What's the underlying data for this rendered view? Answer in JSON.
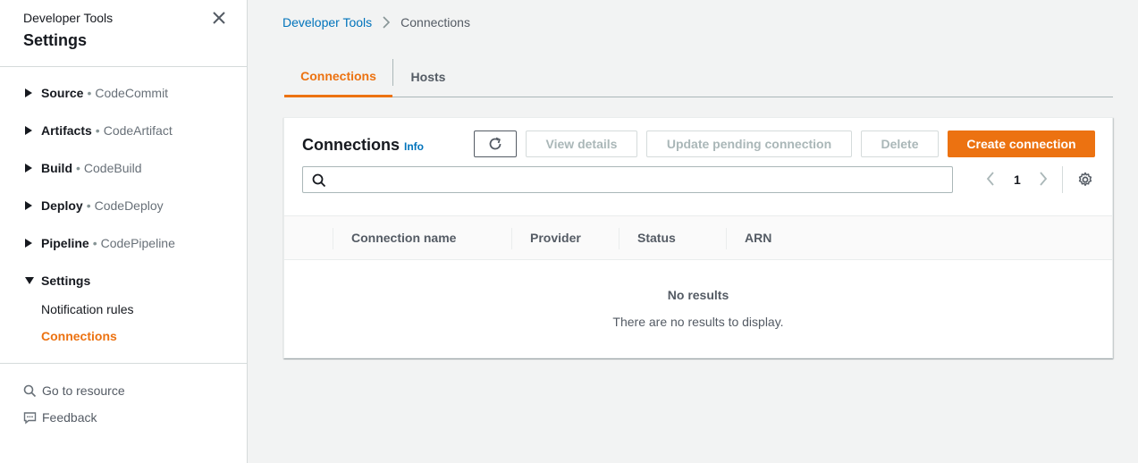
{
  "sidebar": {
    "header_sup": "Developer Tools",
    "title": "Settings",
    "items": [
      {
        "label": "Source",
        "sub": "CodeCommit"
      },
      {
        "label": "Artifacts",
        "sub": "CodeArtifact"
      },
      {
        "label": "Build",
        "sub": "CodeBuild"
      },
      {
        "label": "Deploy",
        "sub": "CodeDeploy"
      },
      {
        "label": "Pipeline",
        "sub": "CodePipeline"
      },
      {
        "label": "Settings",
        "children": [
          "Notification rules",
          "Connections"
        ]
      }
    ],
    "dot": "•",
    "go_to_resource": "Go to resource",
    "feedback": "Feedback"
  },
  "breadcrumb": {
    "root": "Developer Tools",
    "current": "Connections"
  },
  "tabs": [
    {
      "label": "Connections",
      "active": true
    },
    {
      "label": "Hosts",
      "active": false
    }
  ],
  "panel": {
    "title": "Connections",
    "info": "Info",
    "buttons": {
      "view_details": "View details",
      "update_pending": "Update pending connection",
      "delete": "Delete",
      "create": "Create connection"
    },
    "search": {
      "value": "",
      "placeholder": ""
    },
    "page_number": "1",
    "columns": [
      "Connection name",
      "Provider",
      "Status",
      "ARN"
    ],
    "empty_title": "No results",
    "empty_text": "There are no results to display."
  },
  "colors": {
    "accent": "#ec7211",
    "link": "#0073bb"
  }
}
